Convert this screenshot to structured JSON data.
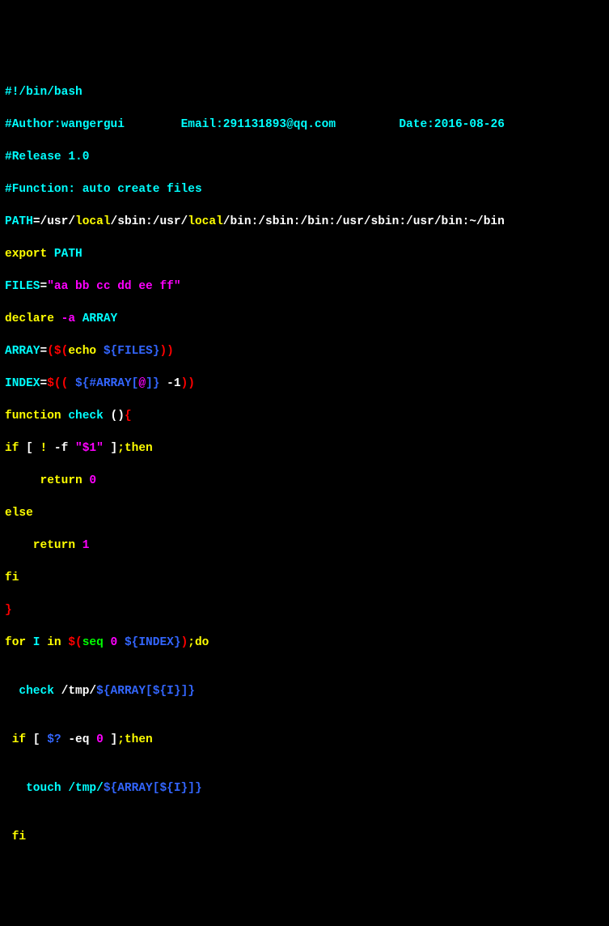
{
  "l1": {
    "shebang": "#!/bin/bash"
  },
  "l2": {
    "author_lbl": "#Author:",
    "author": "wangergui",
    "email_lbl": "Email:",
    "email": "291131893@qq.com",
    "date_lbl": "Date:",
    "date": "2016-08-26"
  },
  "l3": {
    "release": "#Release 1.0"
  },
  "l4": {
    "func": "#Function: auto create files"
  },
  "l5": {
    "path_lbl": "PATH",
    "eq": "=/usr/",
    "local": "local",
    "seg1": "/sbin:/usr/",
    "seg2": "/bin:/sbin:/bin:/usr/sbin:/usr/bin:~/bin"
  },
  "l6": {
    "export": "export",
    "path": " PATH"
  },
  "l7": {
    "files": "FILES",
    "eq": "=",
    "val": "\"aa bb cc dd ee ff\""
  },
  "l8": {
    "declare": "declare",
    "flag": " -a",
    "arr": " ARRAY"
  },
  "l9": {
    "arr": "ARRAY",
    "eq": "=",
    "p1": "(",
    "d1": "$(",
    "echo": "echo ",
    "var": "${FILES}",
    "p2": ")",
    ")": ")"
  },
  "l10": {
    "idx": "INDEX",
    "eq": "=",
    "d1": "$((",
    "sp": " ",
    "var": "${#ARRAY[",
    "at": "@",
    "rb": "]}",
    "m1": " -1",
    "p2": "))"
  },
  "l11": {
    "fn": "function",
    "name": " check ",
    "p": "()",
    "b": "{"
  },
  "l12": {
    "if": "if",
    "lb": " [ ",
    "neg": "!",
    "f": " -f ",
    "arg": "\"$1\"",
    "rb": " ]",
    "semi": ";",
    "then": "then"
  },
  "l13": {
    "ret": "     return",
    "val": " 0"
  },
  "l14": {
    "else": "else"
  },
  "l15": {
    "ret": "    return",
    "val": " 1"
  },
  "l16": {
    "fi": "fi"
  },
  "l17": {
    "rb": "}"
  },
  "l18": {
    "for": "for",
    "i": " I ",
    "in": "in",
    "sp": " ",
    "d": "$(",
    "seq": "seq ",
    "z": "0",
    "sp2": " ",
    "idx": "${INDEX}",
    "cp": ")",
    "semi": ";",
    "do": "do"
  },
  "l19": {
    "blank": ""
  },
  "l20": {
    "ind": "  ",
    "chk": "check ",
    "p": "/tmp/",
    "var": "${ARRAY[",
    "i": "${I}",
    "rb": "]}"
  },
  "l21": {
    "blank": ""
  },
  "l22": {
    "sp": " ",
    "if": "if",
    "lb": " [ ",
    "var": "$?",
    "eq": " -eq ",
    "z": "0",
    "rb": " ]",
    "semi": ";",
    "then": "then"
  },
  "l23": {
    "blank": ""
  },
  "l24": {
    "ind": "   ",
    "touch": "touch /tmp/",
    "var": "${ARRAY[",
    "i": "${I}",
    "rb": "]}"
  },
  "l25": {
    "blank": ""
  },
  "l26": {
    "sp": " ",
    "fi": "fi"
  }
}
